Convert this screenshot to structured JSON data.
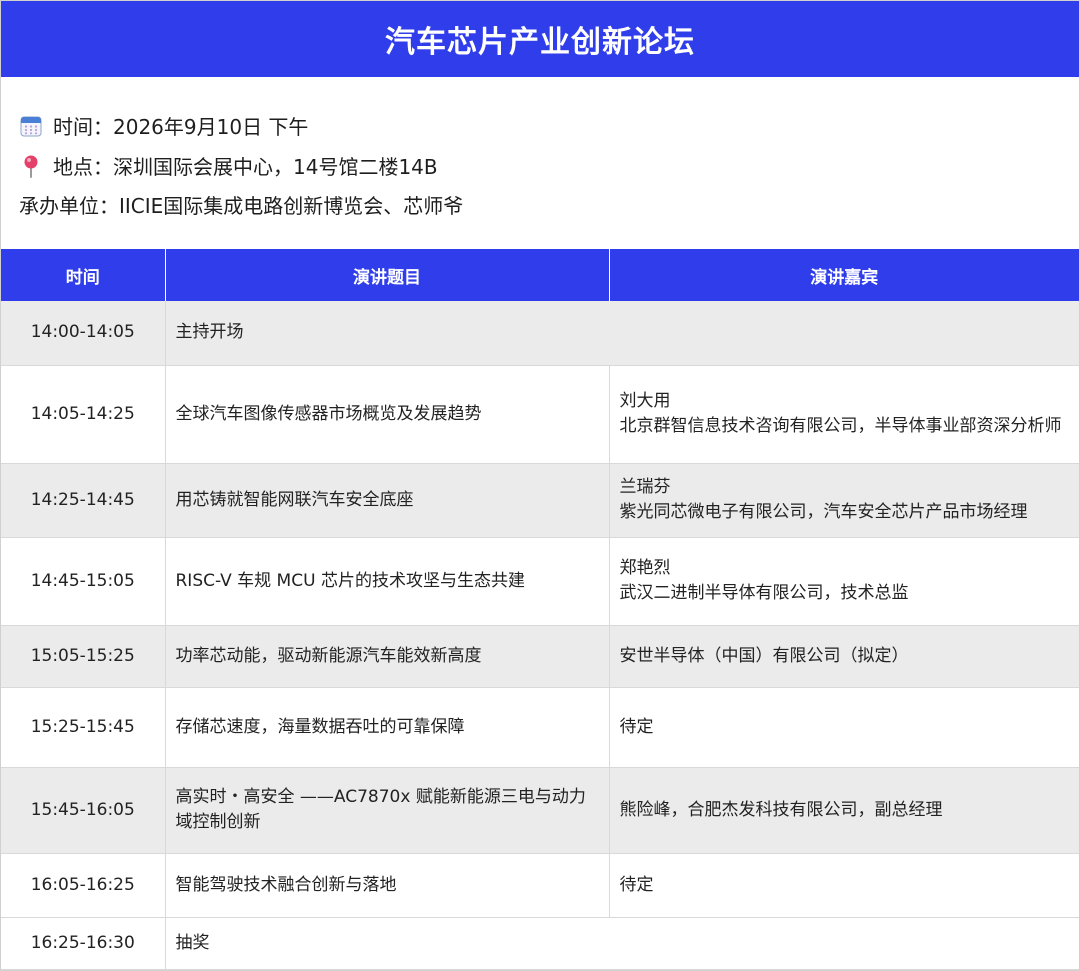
{
  "header": {
    "title": "汽车芯片产业创新论坛"
  },
  "info": {
    "time_label": "时间：2026年9月10日 下午",
    "place_label": "地点：深圳国际会展中心，14号馆二楼14B",
    "organizer_label": "承办单位：IICIE国际集成电路创新博览会、芯师爷"
  },
  "icons": {
    "time": "calendar-icon",
    "place": "location-pin-icon"
  },
  "colors": {
    "accent": "#2f3dea",
    "row_shade": "#ebebeb",
    "pin": "#e5406a"
  },
  "table": {
    "headers": {
      "time": "时间",
      "topic": "演讲题目",
      "speaker": "演讲嘉宾"
    },
    "rows": [
      {
        "time": "14:00-14:05",
        "topic": "主持开场",
        "speaker": ""
      },
      {
        "time": "14:05-14:25",
        "topic": "全球汽车图像传感器市场概览及发展趋势",
        "speaker": "刘大用\n北京群智信息技术咨询有限公司，半导体事业部资深分析师"
      },
      {
        "time": "14:25-14:45",
        "topic": "用芯铸就智能网联汽车安全底座",
        "speaker": "兰瑞芬\n紫光同芯微电子有限公司，汽车安全芯片产品市场经理"
      },
      {
        "time": "14:45-15:05",
        "topic": "RISC-V 车规 MCU 芯片的技术攻坚与生态共建",
        "speaker": "郑艳烈\n武汉二进制半导体有限公司，技术总监"
      },
      {
        "time": "15:05-15:25",
        "topic": "功率芯动能，驱动新能源汽车能效新高度",
        "speaker": "安世半导体（中国）有限公司（拟定）"
      },
      {
        "time": "15:25-15:45",
        "topic": "存储芯速度，海量数据吞吐的可靠保障",
        "speaker": "待定"
      },
      {
        "time": "15:45-16:05",
        "topic": "高实时・高安全 ——AC7870x 赋能新能源三电与动力域控制创新",
        "speaker": "熊险峰，合肥杰发科技有限公司，副总经理"
      },
      {
        "time": "16:05-16:25",
        "topic": "智能驾驶技术融合创新与落地",
        "speaker": "待定"
      },
      {
        "time": "16:25-16:30",
        "topic": "抽奖",
        "speaker": ""
      }
    ]
  }
}
